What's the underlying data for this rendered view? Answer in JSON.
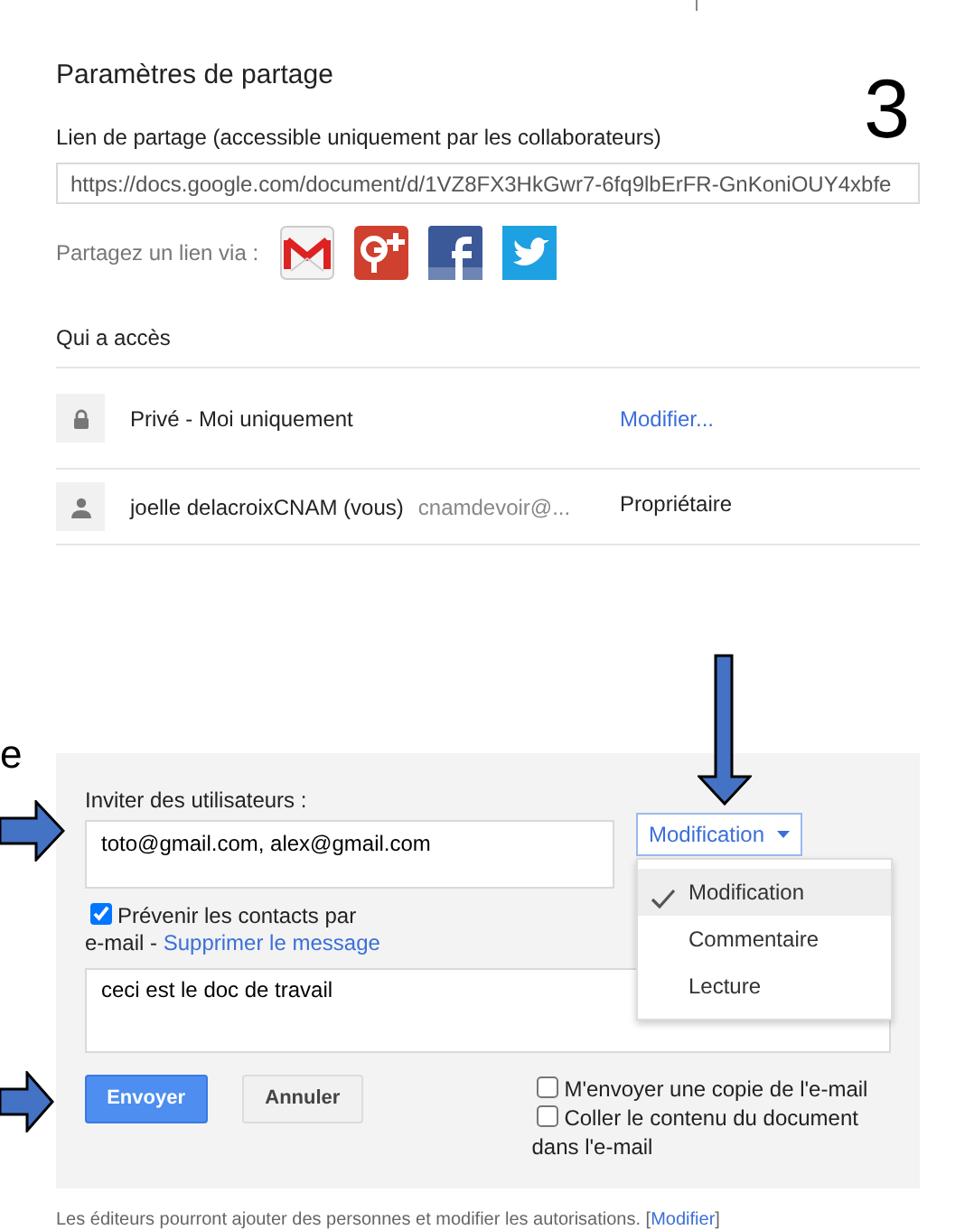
{
  "title": "Paramètres de partage",
  "annotation_number": "3",
  "cut_text": "e",
  "link": {
    "label": "Lien de partage (accessible uniquement par les collaborateurs)",
    "value": "https://docs.google.com/document/d/1VZ8FX3HkGwr7-6fq9lbErFR-GnKoniOUY4xbfe"
  },
  "share_via": {
    "label": "Partagez un lien via :",
    "services": [
      {
        "kind": "gmail"
      },
      {
        "kind": "gplus"
      },
      {
        "kind": "facebook"
      },
      {
        "kind": "twitter"
      }
    ]
  },
  "access": {
    "heading": "Qui a accès",
    "entries": [
      {
        "kind": "visibility",
        "name": "Privé - Moi uniquement",
        "action": "Modifier..."
      },
      {
        "kind": "person",
        "name": "joelle delacroixCNAM (vous)",
        "email": "cnamdevoir@...",
        "role": "Propriétaire"
      }
    ]
  },
  "invite": {
    "label": "Inviter des utilisateurs :",
    "value": "toto@gmail.com, alex@gmail.com",
    "permission": "Modification",
    "menu": [
      {
        "label": "Modification",
        "selected": true
      },
      {
        "label": "Commentaire",
        "selected": false
      },
      {
        "label": "Lecture",
        "selected": false
      }
    ],
    "notify": {
      "checked": true,
      "label": "Prévenir les contacts par",
      "label_continued": "e-mail -",
      "link": "Supprimer le message"
    },
    "message": "ceci est le doc de travail",
    "buttons": [
      {
        "label": "Envoyer",
        "kind": "primary"
      },
      {
        "label": "Annuler",
        "kind": "secondary"
      }
    ],
    "options": [
      {
        "label": "M'envoyer une copie de l'e-mail",
        "checked": false
      },
      {
        "label": "Coller le contenu du document",
        "label_continued": "dans l'e-mail",
        "checked": false
      }
    ]
  },
  "footer": {
    "text": "Les éditeurs pourront ajouter des personnes et modifier les autorisations. [",
    "link": "Modifier",
    "closing": "]"
  }
}
